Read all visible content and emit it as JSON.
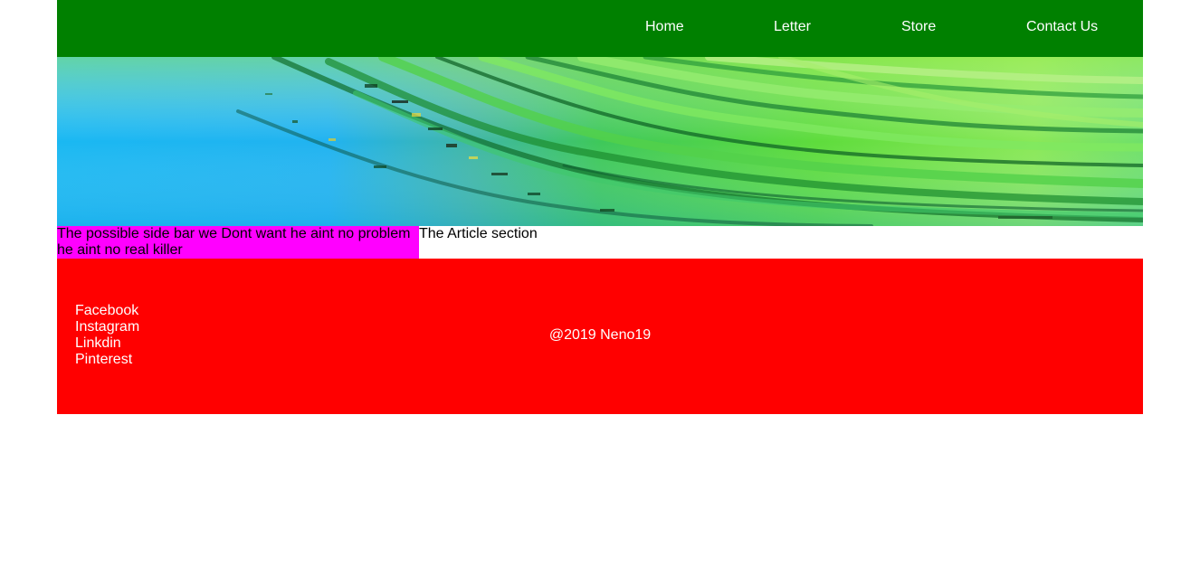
{
  "colors": {
    "nav_bg": "#008000",
    "sidebar_bg": "#ff00ff",
    "footer_bg": "#ff0000",
    "text_light": "#ffffff",
    "text_dark": "#000000"
  },
  "nav": {
    "items": [
      {
        "label": "Home"
      },
      {
        "label": "Letter"
      },
      {
        "label": "Store"
      },
      {
        "label": "Contact Us"
      }
    ]
  },
  "hero": {
    "image": "abstract-blue-green-wave-banner"
  },
  "sidebar": {
    "text": "The possible side bar we Dont want he aint no problem he aint no real killer"
  },
  "article": {
    "text": "The Article section"
  },
  "footer": {
    "social": [
      {
        "label": "Facebook"
      },
      {
        "label": "Instagram"
      },
      {
        "label": "Linkdin"
      },
      {
        "label": "Pinterest"
      }
    ],
    "copyright": "@2019 Neno19"
  }
}
